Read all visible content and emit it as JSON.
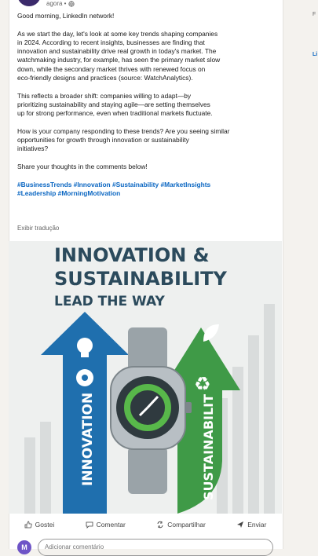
{
  "post": {
    "time": "agora •",
    "greeting": "Good morning, LinkedIn network!",
    "paragraph1": "As we start the day, let's look at some key trends shaping companies\nin 2024. According to recent insights, businesses are finding that\ninnovation and sustainability drive real growth in today's market. The\nwatchmaking industry, for example, has seen the primary market slow\ndown, while the secondary market thrives with renewed focus on\neco-friendly designs and practices (source: WatchAnalytics).",
    "paragraph2": "This reflects a broader shift: companies willing to adapt—by\nprioritizing sustainability and staying agile—are setting themselves\nup for strong performance, even when traditional markets fluctuate.",
    "paragraph3": "How is your company responding to these trends? Are you seeing similar\nopportunities for growth through innovation or sustainability\ninitiatives?",
    "paragraph4": "Share your thoughts in the comments below!",
    "hashtags": "#BusinessTrends #Innovation #Sustainability #MarketInsights\n#Leadership #MorningMotivation",
    "translate_label": "Exibir tradução"
  },
  "image": {
    "headline1": "INNOVATION &",
    "headline2": "SUSTAINABILITY",
    "headline3": "LEAD THE WAY",
    "left_arrow_label": "INNOVATION",
    "right_arrow_label": "SUSTAINABILIT",
    "colors": {
      "blue": "#1f6fae",
      "green": "#3f9a47",
      "navy": "#2b4a5c"
    }
  },
  "actions": {
    "like": "Gostei",
    "comment": "Comentar",
    "share": "Compartilhar",
    "send": "Enviar"
  },
  "comment": {
    "avatar_initial": "M",
    "placeholder": "Adicionar comentário"
  },
  "side": {
    "f": "F",
    "l": "Li"
  }
}
